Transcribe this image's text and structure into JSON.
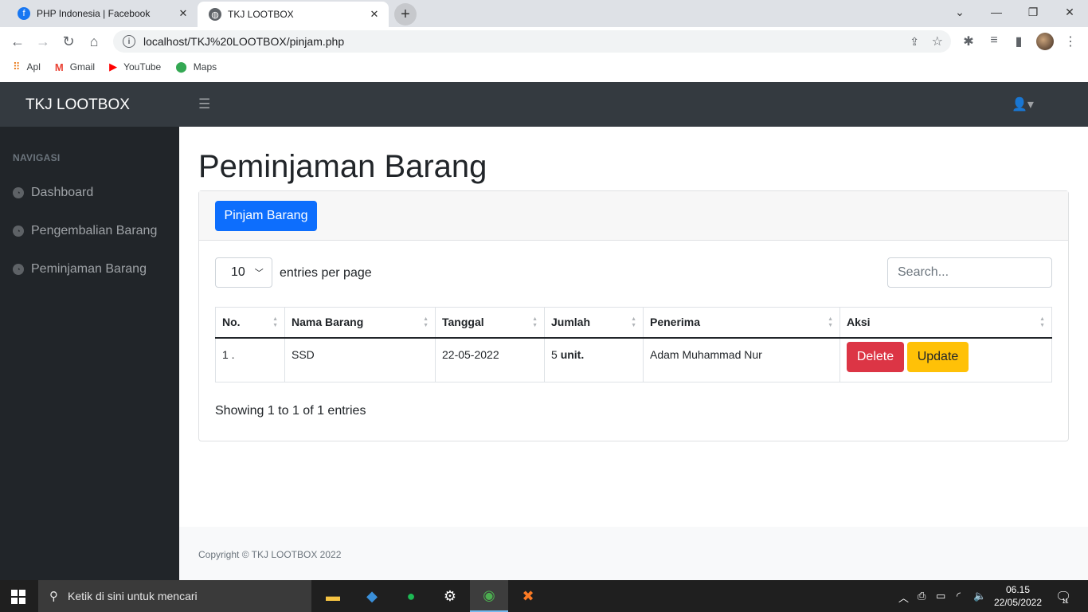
{
  "browser": {
    "tabs": [
      {
        "title": "PHP Indonesia | Facebook",
        "favicon": "facebook-icon",
        "color": "#1877f2"
      },
      {
        "title": "TKJ LOOTBOX",
        "favicon": "globe-icon",
        "color": "#5f6368"
      }
    ],
    "url": "localhost/TKJ%20LOOTBOX/pinjam.php",
    "bookmarks": [
      "Apl",
      "Gmail",
      "YouTube",
      "Maps"
    ]
  },
  "app": {
    "brand": "TKJ LOOTBOX",
    "sidebar": {
      "heading": "NAVIGASI",
      "items": [
        "Dashboard",
        "Pengembalian Barang",
        "Peminjaman Barang"
      ]
    },
    "page_title": "Peminjaman Barang",
    "add_button": "Pinjam Barang",
    "per_page": {
      "value": "10",
      "label": "entries per page"
    },
    "search_placeholder": "Search...",
    "table": {
      "columns": [
        "No.",
        "Nama Barang",
        "Tanggal",
        "Jumlah",
        "Penerima",
        "Aksi"
      ],
      "rows": [
        {
          "no": "1 .",
          "nama": "SSD",
          "tanggal": "22-05-2022",
          "jumlah_num": "5",
          "jumlah_unit": "unit.",
          "penerima": "Adam Muhammad Nur",
          "delete": "Delete",
          "update": "Update"
        }
      ]
    },
    "showing": "Showing 1 to 1 of 1 entries",
    "footer": "Copyright © TKJ LOOTBOX 2022",
    "colors": {
      "primary": "#0d6efd",
      "danger": "#dc3545",
      "warning": "#ffc107",
      "header": "#343a40",
      "sidebar": "#212529"
    }
  },
  "taskbar": {
    "search_placeholder": "Ketik di sini untuk mencari",
    "time": "06.15",
    "date": "22/05/2022",
    "notifications": "11"
  }
}
